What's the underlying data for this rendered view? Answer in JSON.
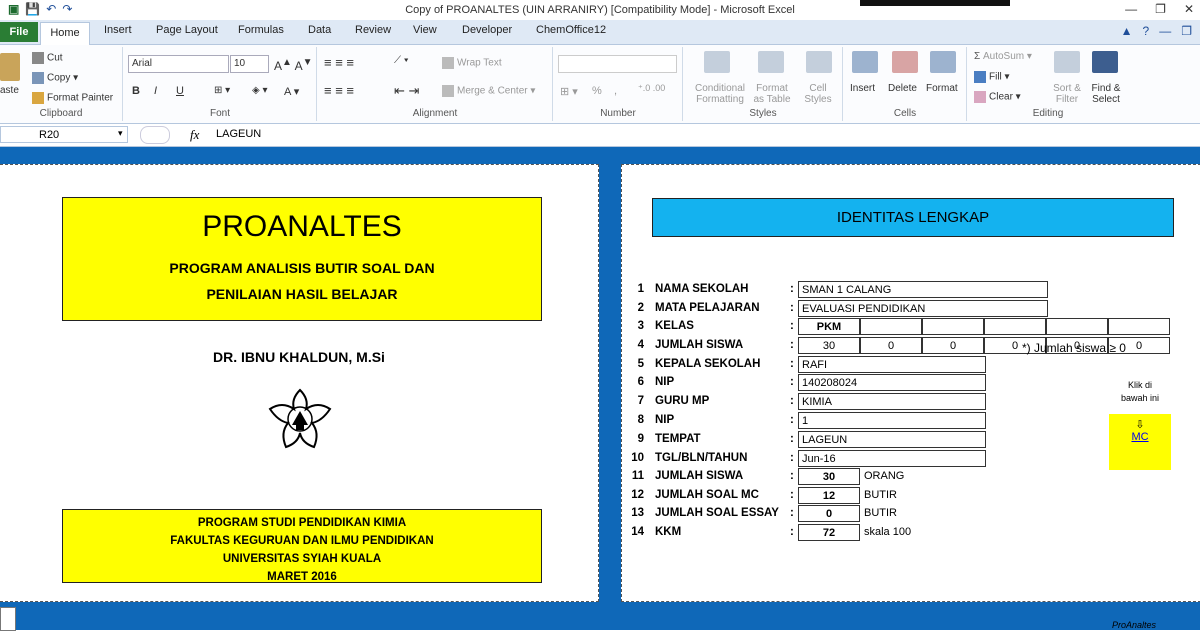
{
  "window": {
    "title": "Copy of PROANALTES (UIN ARRANIRY)  [Compatibility Mode]  -  Microsoft Excel"
  },
  "tabs": [
    "File",
    "Home",
    "Insert",
    "Page Layout",
    "Formulas",
    "Data",
    "Review",
    "View",
    "Developer",
    "ChemOffice12"
  ],
  "ribbon": {
    "clipboard": {
      "paste": "aste",
      "cut": "Cut",
      "copy": "Copy",
      "format_painter": "Format Painter",
      "group": "Clipboard"
    },
    "font": {
      "font_name": "Arial",
      "font_size": "10",
      "bold": "B",
      "italic": "I",
      "underline": "U",
      "group": "Font"
    },
    "alignment": {
      "wrap_text": "Wrap Text",
      "merge_center": "Merge & Center",
      "group": "Alignment"
    },
    "number": {
      "percent": "%",
      "comma": ",",
      "group": "Number"
    },
    "styles": {
      "conditional": "Conditional",
      "conditional2": "Formatting",
      "format_as": "Format",
      "format_as2": "as Table",
      "cell": "Cell",
      "cell2": "Styles",
      "group": "Styles"
    },
    "cells": {
      "insert": "Insert",
      "delete": "Delete",
      "format": "Format",
      "group": "Cells"
    },
    "editing": {
      "autosum": "AutoSum",
      "fill": "Fill",
      "clear": "Clear",
      "sort": "Sort &",
      "sort2": "Filter",
      "find": "Find &",
      "find2": "Select",
      "group": "Editing"
    }
  },
  "formula_bar": {
    "name_box": "R20",
    "fx": "fx",
    "value": "LAGEUN"
  },
  "left_panel": {
    "title": "PROANALTES",
    "subtitle1": "PROGRAM ANALISIS BUTIR SOAL  DAN",
    "subtitle2": "PENILAIAN  HASIL BELAJAR",
    "author": "DR. IBNU KHALDUN, M.Si",
    "footer": [
      "PROGRAM STUDI PENDIDIKAN KIMIA",
      "FAKULTAS KEGURUAN DAN ILMU PENDIDIKAN",
      "UNIVERSITAS SYIAH KUALA",
      "MARET 2016"
    ]
  },
  "right_panel": {
    "banner": "IDENTITAS LENGKAP",
    "rows": [
      {
        "no": "1",
        "label": "NAMA SEKOLAH",
        "value": "SMAN 1 CALANG"
      },
      {
        "no": "2",
        "label": "MATA PELAJARAN",
        "value": "EVALUASI PENDIDIKAN"
      },
      {
        "no": "3",
        "label": "KELAS",
        "value": "PKM"
      },
      {
        "no": "4",
        "label": "JUMLAH SISWA",
        "value": "30"
      },
      {
        "no": "5",
        "label": "KEPALA SEKOLAH",
        "value": "RAFI"
      },
      {
        "no": "6",
        "label": "NIP",
        "value": "140208024"
      },
      {
        "no": "7",
        "label": "GURU MP",
        "value": "KIMIA"
      },
      {
        "no": "8",
        "label": "NIP",
        "value": "1"
      },
      {
        "no": "9",
        "label": "TEMPAT",
        "value": "LAGEUN"
      },
      {
        "no": "10",
        "label": "TGL/BLN/TAHUN",
        "value": "Jun-16"
      },
      {
        "no": "11",
        "label": "JUMLAH SISWA",
        "value": "30",
        "unit": "ORANG"
      },
      {
        "no": "12",
        "label": "JUMLAH SOAL MC",
        "value": "12",
        "unit": "BUTIR"
      },
      {
        "no": "13",
        "label": "JUMLAH SOAL ESSAY",
        "value": "0",
        "unit": "BUTIR"
      },
      {
        "no": "14",
        "label": "KKM",
        "value": "72",
        "unit": "skala 100"
      }
    ],
    "colon": ":",
    "extra_counts": [
      "0",
      "0",
      "0",
      "0",
      "0"
    ],
    "note": "*) Jumlah siswa ≥ 0",
    "click_hint1": "Klik di",
    "click_hint2": "bawah ini",
    "arrow": "⇩",
    "mc_link": "MC"
  },
  "footer_label": "ProAnaltes"
}
